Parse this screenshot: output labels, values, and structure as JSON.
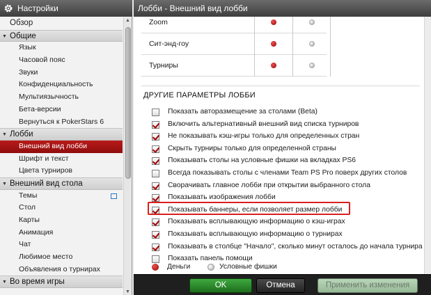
{
  "sidebar": {
    "title": "Настройки",
    "items": [
      {
        "label": "Обзор",
        "kind": "top"
      },
      {
        "label": "Общие",
        "kind": "section"
      },
      {
        "label": "Язык",
        "kind": "item"
      },
      {
        "label": "Часовой пояс",
        "kind": "item"
      },
      {
        "label": "Звуки",
        "kind": "item"
      },
      {
        "label": "Конфиденциальность",
        "kind": "item"
      },
      {
        "label": "Мультиязычность",
        "kind": "item"
      },
      {
        "label": "Бета-версии",
        "kind": "item"
      },
      {
        "label": "Вернуться к PokerStars 6",
        "kind": "item"
      },
      {
        "label": "Лобби",
        "kind": "section"
      },
      {
        "label": "Внешний вид лобби",
        "kind": "item",
        "selected": true
      },
      {
        "label": "Шрифт и текст",
        "kind": "item"
      },
      {
        "label": "Цвета турниров",
        "kind": "item"
      },
      {
        "label": "Внешний вид стола",
        "kind": "section"
      },
      {
        "label": "Темы",
        "kind": "item",
        "external": true
      },
      {
        "label": "Стол",
        "kind": "item"
      },
      {
        "label": "Карты",
        "kind": "item"
      },
      {
        "label": "Анимация",
        "kind": "item"
      },
      {
        "label": "Чат",
        "kind": "item"
      },
      {
        "label": "Любимое место",
        "kind": "item"
      },
      {
        "label": "Объявления о турнирах",
        "kind": "item"
      },
      {
        "label": "Во время игры",
        "kind": "section"
      }
    ]
  },
  "main": {
    "title": "Лобби - Внешний вид лобби",
    "grid_rows": [
      {
        "label": "Zoom",
        "col1": "red",
        "col2": "grey"
      },
      {
        "label": "Сит-энд-гоу",
        "col1": "red",
        "col2": "grey"
      },
      {
        "label": "Турниры",
        "col1": "red",
        "col2": "grey"
      }
    ],
    "section_title": "ДРУГИЕ ПАРАМЕТРЫ ЛОББИ",
    "options": [
      {
        "label": "Показать авторазмещение за столами (Beta)",
        "checked": false
      },
      {
        "label": "Включить альтернативный внешний вид списка турниров",
        "checked": true
      },
      {
        "label": "Не показывать кэш-игры только для определенных стран",
        "checked": true
      },
      {
        "label": "Скрыть турниры только для определенной страны",
        "checked": true
      },
      {
        "label": "Показывать столы на условные фишки на вкладках PS6",
        "checked": true
      },
      {
        "label": "Всегда показывать столы с членами Team PS Pro поверх других столов",
        "checked": false
      },
      {
        "label": "Сворачивать главное лобби при открытии выбранного стола",
        "checked": true
      },
      {
        "label": "Показывать изображения лобби",
        "checked": true
      },
      {
        "label": "Показывать баннеры, если позволяет размер лобби",
        "checked": true,
        "highlighted": true
      },
      {
        "label": "Показывать всплывающую информацию о кэш-играх",
        "checked": true
      },
      {
        "label": "Показывать всплывающую информацию о турнирах",
        "checked": true
      },
      {
        "label": "Показывать в столбце \"Начало\", сколько минут осталось до начала турнира",
        "checked": true
      },
      {
        "label": "Показать панель помощи",
        "checked": false
      }
    ],
    "radio": {
      "option1": "Деньги",
      "option2": "Условные фишки",
      "selected": "Деньги"
    }
  },
  "footer": {
    "ok_label": "OK",
    "cancel_label": "Отмена",
    "apply_label": "Применить изменения"
  },
  "colors": {
    "accent_red": "#b91a1a",
    "ok_green": "#2f8f2f",
    "highlight_border": "#d81f1f"
  }
}
